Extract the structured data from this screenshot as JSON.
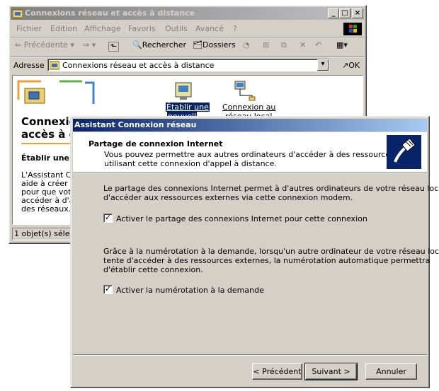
{
  "explorer": {
    "title": "Connexions réseau et accès à distance",
    "menu": [
      "Fichier",
      "Edition",
      "Affichage",
      "Favoris",
      "Outils",
      "Avancé",
      "?"
    ],
    "toolbar": {
      "back_label": "Précédente",
      "search_label": "Rechercher",
      "folders_label": "Dossiers"
    },
    "address": {
      "label": "Adresse",
      "value": "Connexions réseau et accès à distance",
      "go_label": "OK"
    },
    "content": {
      "heading_line1": "Connexions réseau et",
      "heading_line2": "accès à d",
      "subheading": "Établir une n",
      "body_lines": [
        "L'Assistant Con",
        "aide à créer un",
        "pour que votre",
        "accéder à d'aut",
        "des réseaux."
      ],
      "icons": [
        {
          "label_line1": "Établir une",
          "label_line2": "nouvell"
        },
        {
          "label_line1": "Connexion au",
          "label_line2": "réseau local"
        }
      ]
    },
    "status": "1 objet(s) sélection"
  },
  "wizard": {
    "title": "Assistant Connexion réseau",
    "header_title": "Partage de connexion Internet",
    "header_desc_line1": "Vous pouvez permettre aux autres ordinateurs d'accéder à des ressources en",
    "header_desc_line2": "utilisant cette connexion d'appel à distance.",
    "para1_line1": "Le partage des connexions Internet permet à d'autres ordinateurs de votre réseau local",
    "para1_line2": "d'accéder aux ressources externes via cette connexion modem.",
    "checkbox1_label": "Activer le partage des connexions Internet pour cette connexion",
    "checkbox1_checked": true,
    "para2_line1": "Grâce à la numérotation à la demande, lorsqu'un autre ordinateur de votre réseau local",
    "para2_line2": "tente d'accéder à des ressources externes, la numérotation automatique permettra",
    "para2_line3": "d'établir cette connexion.",
    "checkbox2_label": "Activer la numérotation à la demande",
    "checkbox2_checked": true,
    "buttons": {
      "back": "< Précédent",
      "next": "Suivant >",
      "cancel": "Annuler"
    }
  },
  "colors": {
    "active_title": "#0a246a",
    "inactive_title": "#808080",
    "face": "#d4d0c8"
  }
}
